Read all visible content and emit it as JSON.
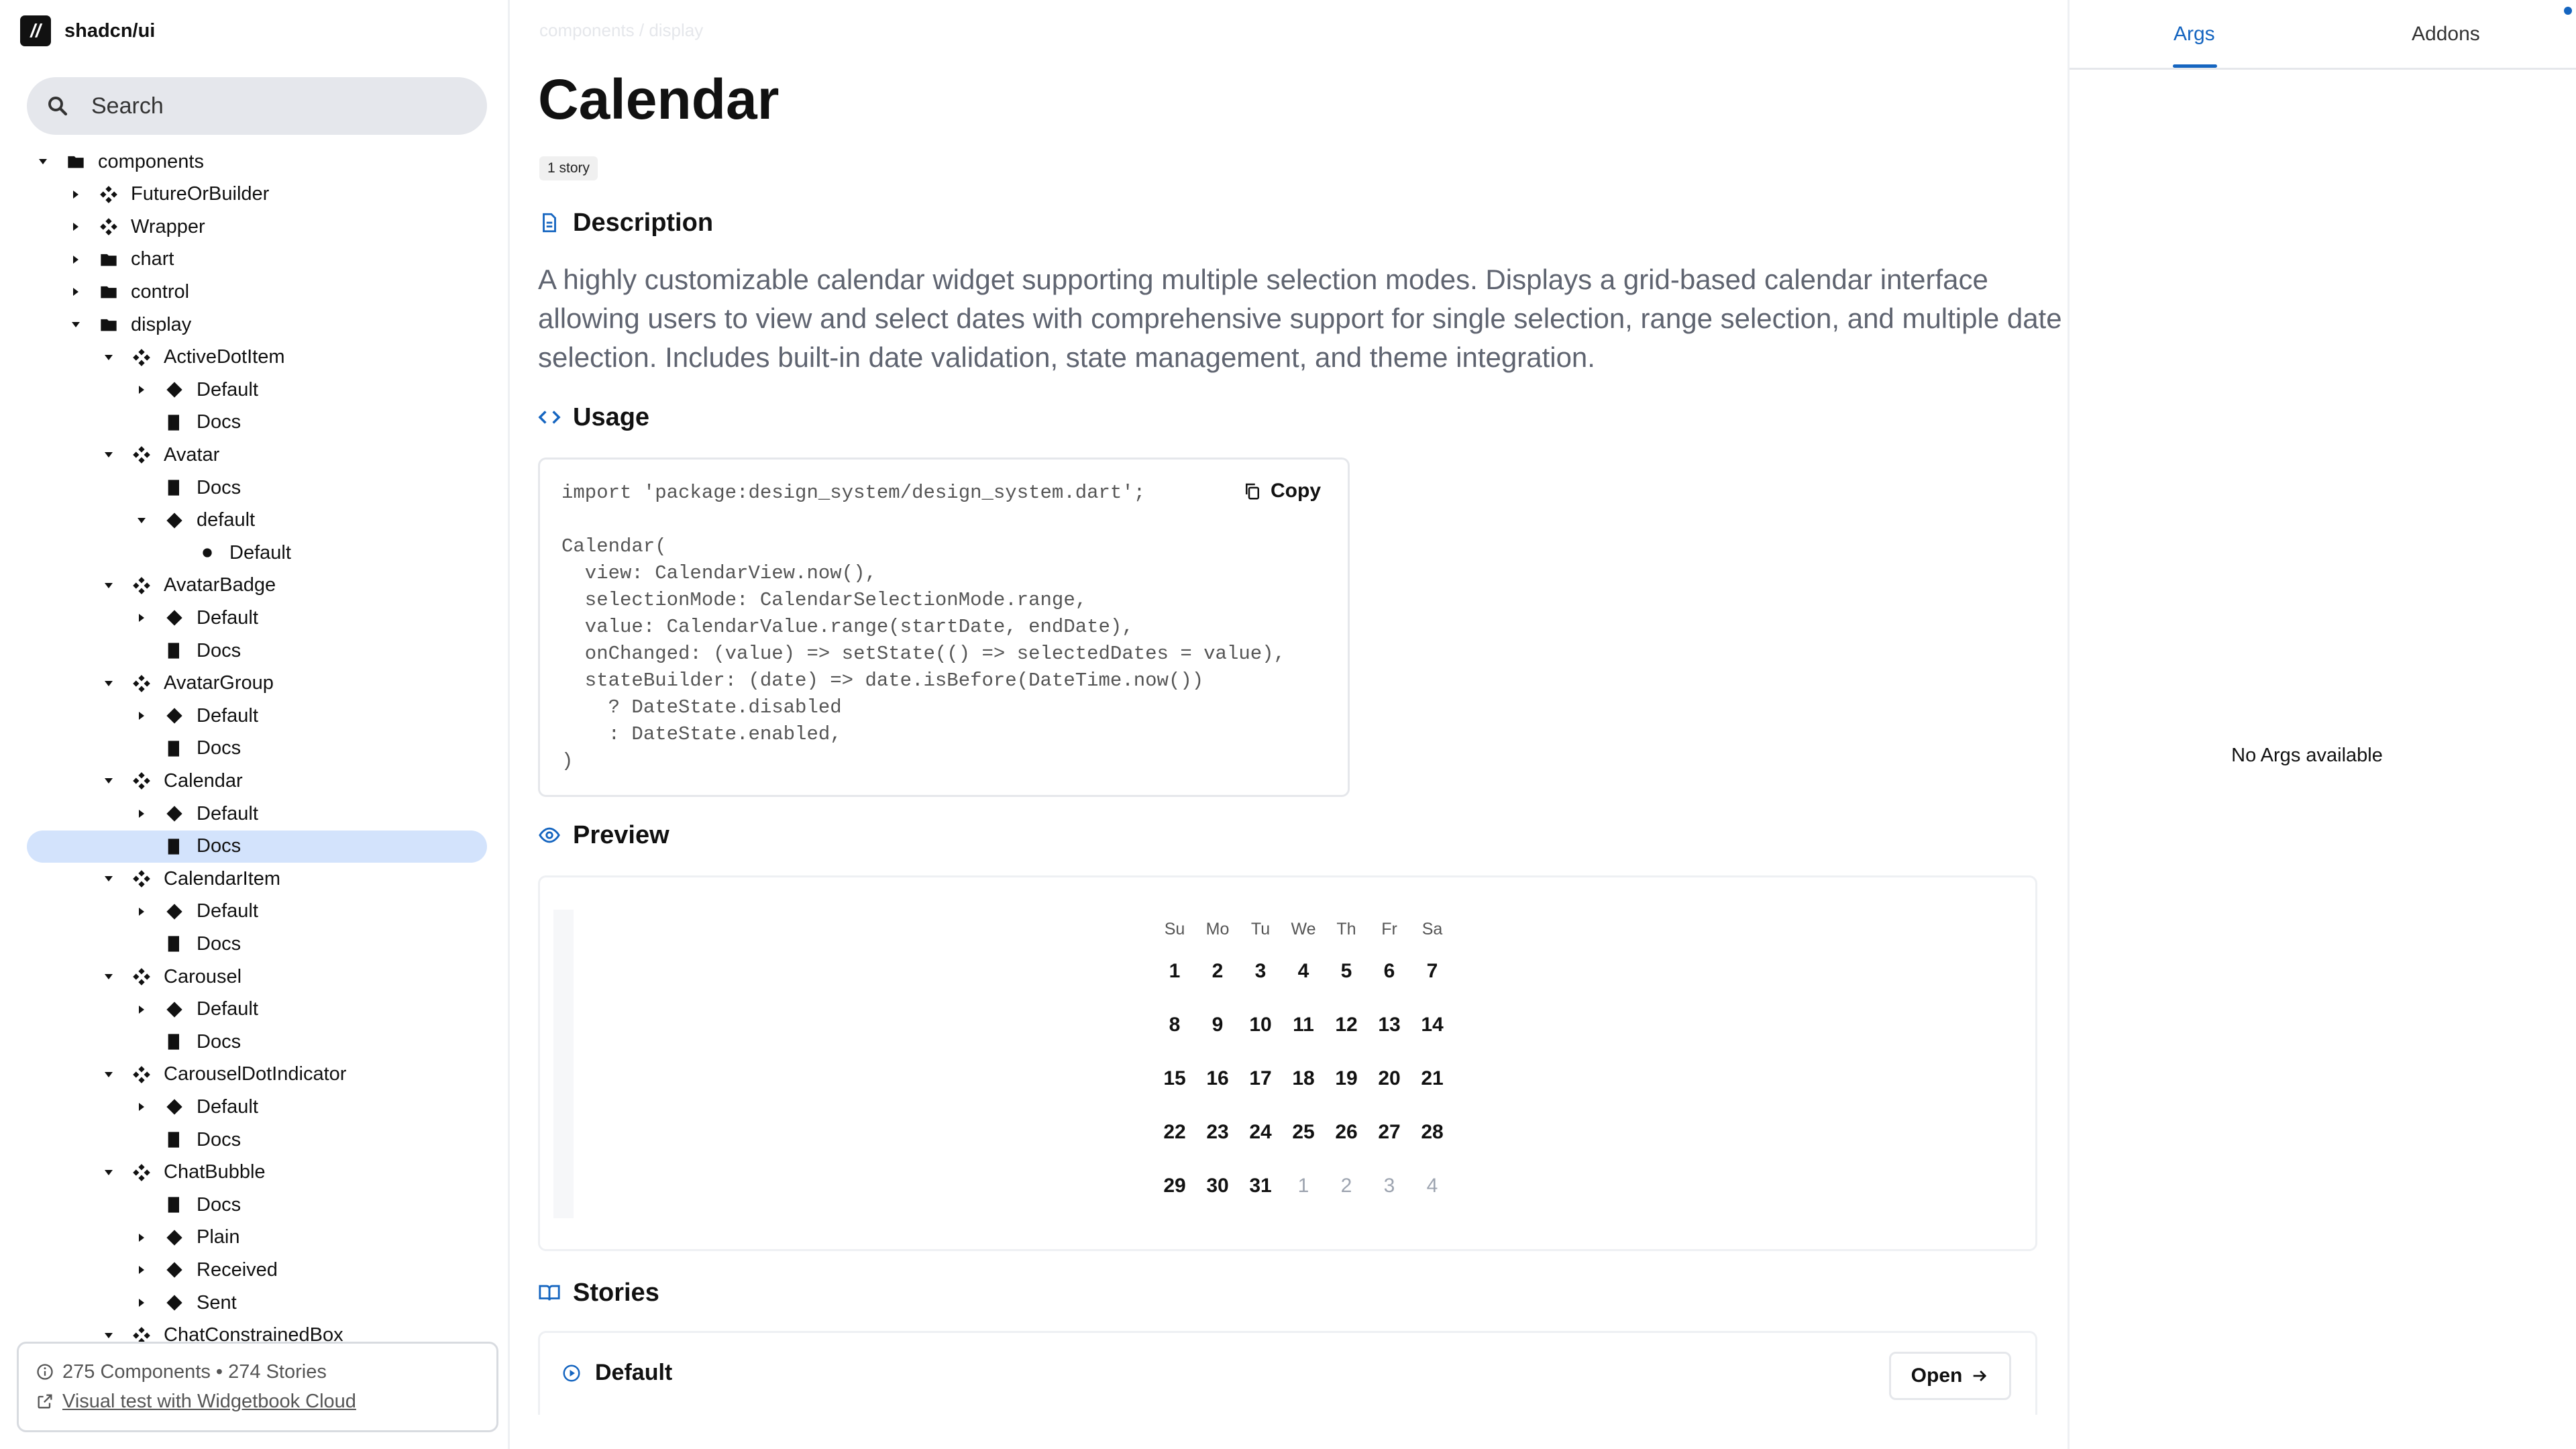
{
  "brand": {
    "logo_text": "//",
    "name": "shadcn/ui"
  },
  "search": {
    "placeholder": "Search"
  },
  "tree": [
    {
      "label": "components",
      "depth": 0,
      "icon": "folder",
      "toggle": "down"
    },
    {
      "label": "FutureOrBuilder",
      "depth": 1,
      "icon": "component",
      "toggle": "right"
    },
    {
      "label": "Wrapper",
      "depth": 1,
      "icon": "component",
      "toggle": "right"
    },
    {
      "label": "chart",
      "depth": 1,
      "icon": "folder",
      "toggle": "right"
    },
    {
      "label": "control",
      "depth": 1,
      "icon": "folder",
      "toggle": "right"
    },
    {
      "label": "display",
      "depth": 1,
      "icon": "folder",
      "toggle": "down"
    },
    {
      "label": "ActiveDotItem",
      "depth": 2,
      "icon": "component",
      "toggle": "down"
    },
    {
      "label": "Default",
      "depth": 3,
      "icon": "diamond",
      "toggle": "right"
    },
    {
      "label": "Docs",
      "depth": 3,
      "icon": "book",
      "toggle": "none"
    },
    {
      "label": "Avatar",
      "depth": 2,
      "icon": "component",
      "toggle": "down"
    },
    {
      "label": "Docs",
      "depth": 3,
      "icon": "book",
      "toggle": "none"
    },
    {
      "label": "default",
      "depth": 3,
      "icon": "diamond",
      "toggle": "down"
    },
    {
      "label": "Default",
      "depth": 4,
      "icon": "dot",
      "toggle": "none"
    },
    {
      "label": "AvatarBadge",
      "depth": 2,
      "icon": "component",
      "toggle": "down"
    },
    {
      "label": "Default",
      "depth": 3,
      "icon": "diamond",
      "toggle": "right"
    },
    {
      "label": "Docs",
      "depth": 3,
      "icon": "book",
      "toggle": "none"
    },
    {
      "label": "AvatarGroup",
      "depth": 2,
      "icon": "component",
      "toggle": "down"
    },
    {
      "label": "Default",
      "depth": 3,
      "icon": "diamond",
      "toggle": "right"
    },
    {
      "label": "Docs",
      "depth": 3,
      "icon": "book",
      "toggle": "none"
    },
    {
      "label": "Calendar",
      "depth": 2,
      "icon": "component",
      "toggle": "down"
    },
    {
      "label": "Default",
      "depth": 3,
      "icon": "diamond",
      "toggle": "right"
    },
    {
      "label": "Docs",
      "depth": 3,
      "icon": "book",
      "toggle": "none",
      "selected": true
    },
    {
      "label": "CalendarItem",
      "depth": 2,
      "icon": "component",
      "toggle": "down"
    },
    {
      "label": "Default",
      "depth": 3,
      "icon": "diamond",
      "toggle": "right"
    },
    {
      "label": "Docs",
      "depth": 3,
      "icon": "book",
      "toggle": "none"
    },
    {
      "label": "Carousel",
      "depth": 2,
      "icon": "component",
      "toggle": "down"
    },
    {
      "label": "Default",
      "depth": 3,
      "icon": "diamond",
      "toggle": "right"
    },
    {
      "label": "Docs",
      "depth": 3,
      "icon": "book",
      "toggle": "none"
    },
    {
      "label": "CarouselDotIndicator",
      "depth": 2,
      "icon": "component",
      "toggle": "down"
    },
    {
      "label": "Default",
      "depth": 3,
      "icon": "diamond",
      "toggle": "right"
    },
    {
      "label": "Docs",
      "depth": 3,
      "icon": "book",
      "toggle": "none"
    },
    {
      "label": "ChatBubble",
      "depth": 2,
      "icon": "component",
      "toggle": "down"
    },
    {
      "label": "Docs",
      "depth": 3,
      "icon": "book",
      "toggle": "none"
    },
    {
      "label": "Plain",
      "depth": 3,
      "icon": "diamond",
      "toggle": "right"
    },
    {
      "label": "Received",
      "depth": 3,
      "icon": "diamond",
      "toggle": "right"
    },
    {
      "label": "Sent",
      "depth": 3,
      "icon": "diamond",
      "toggle": "right"
    },
    {
      "label": "ChatConstrainedBox",
      "depth": 2,
      "icon": "component",
      "toggle": "down"
    }
  ],
  "footer": {
    "stats": "275 Components • 274 Stories",
    "link": "Visual test with Widgetbook Cloud"
  },
  "main": {
    "breadcrumb": "components / display",
    "title": "Calendar",
    "story_badge": "1 story",
    "description_heading": "Description",
    "description": "A highly customizable calendar widget supporting multiple selection modes. Displays a grid-based calendar interface allowing users to view and select dates with comprehensive support for single selection, range selection, and multiple date selection. Includes built-in date validation, state management, and theme integration.",
    "usage_heading": "Usage",
    "code": "import 'package:design_system/design_system.dart';\n\nCalendar(\n  view: CalendarView.now(),\n  selectionMode: CalendarSelectionMode.range,\n  value: CalendarValue.range(startDate, endDate),\n  onChanged: (value) => setState(() => selectedDates = value),\n  stateBuilder: (date) => date.isBefore(DateTime.now())\n    ? DateState.disabled\n    : DateState.enabled,\n)",
    "copy_label": "Copy",
    "preview_heading": "Preview",
    "calendar": {
      "weekdays": [
        "Su",
        "Mo",
        "Tu",
        "We",
        "Th",
        "Fr",
        "Sa"
      ],
      "days": [
        {
          "d": "1"
        },
        {
          "d": "2"
        },
        {
          "d": "3"
        },
        {
          "d": "4"
        },
        {
          "d": "5"
        },
        {
          "d": "6"
        },
        {
          "d": "7"
        },
        {
          "d": "8"
        },
        {
          "d": "9"
        },
        {
          "d": "10"
        },
        {
          "d": "11"
        },
        {
          "d": "12"
        },
        {
          "d": "13"
        },
        {
          "d": "14"
        },
        {
          "d": "15"
        },
        {
          "d": "16"
        },
        {
          "d": "17"
        },
        {
          "d": "18"
        },
        {
          "d": "19"
        },
        {
          "d": "20"
        },
        {
          "d": "21"
        },
        {
          "d": "22"
        },
        {
          "d": "23"
        },
        {
          "d": "24"
        },
        {
          "d": "25"
        },
        {
          "d": "26"
        },
        {
          "d": "27"
        },
        {
          "d": "28"
        },
        {
          "d": "29"
        },
        {
          "d": "30"
        },
        {
          "d": "31"
        },
        {
          "d": "1",
          "outside": true
        },
        {
          "d": "2",
          "outside": true
        },
        {
          "d": "3",
          "outside": true
        },
        {
          "d": "4",
          "outside": true
        }
      ]
    },
    "stories_heading": "Stories",
    "story_default": "Default",
    "open_label": "Open"
  },
  "right_panel": {
    "tabs": [
      "Args",
      "Addons"
    ],
    "active_tab": "Args",
    "empty_message": "No Args available"
  },
  "colors": {
    "accent": "#1565c0",
    "selected_row": "#d3e3fc",
    "search_bg": "#e5e7ec"
  }
}
